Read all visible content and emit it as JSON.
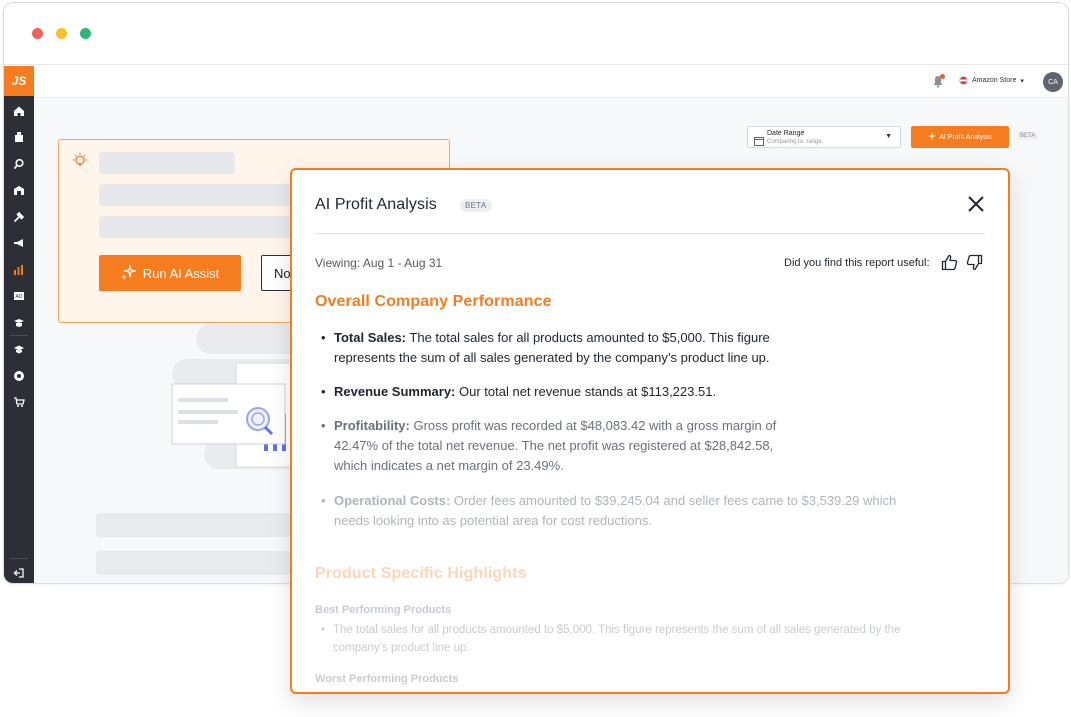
{
  "window": {
    "traffic_lights": [
      "close",
      "minimize",
      "maximize"
    ]
  },
  "sidebar": {
    "logo": "JS",
    "items": [
      {
        "icon": "home-icon"
      },
      {
        "icon": "box-icon"
      },
      {
        "icon": "search-icon"
      },
      {
        "icon": "warehouse-icon"
      },
      {
        "icon": "hammer-icon"
      },
      {
        "icon": "megaphone-icon"
      },
      {
        "icon": "bar-chart-icon",
        "active": true
      },
      {
        "icon": "ad-icon"
      },
      {
        "icon": "graduation-icon"
      },
      {
        "icon": "academy-icon"
      },
      {
        "icon": "chrome-icon"
      },
      {
        "icon": "cart-icon"
      },
      {
        "icon": "logout-icon"
      }
    ]
  },
  "header": {
    "store_label": "Amazon Store",
    "avatar_initials": "CA"
  },
  "toolbar": {
    "date_range_label": "Date Range",
    "date_range_sub": "Comparing to: range",
    "ai_button_label": "AI Profit Analysis",
    "beta_label": "BETA"
  },
  "assist_card": {
    "run_button": "Run AI Assist",
    "no_button": "No,"
  },
  "modal": {
    "title": "AI Profit Analysis",
    "beta": "BETA",
    "viewing": "Viewing: Aug 1 - Aug 31",
    "feedback_prompt": "Did you find this report useful:",
    "section1_title": "Overall Company Performance",
    "bullets": [
      {
        "label": "Total Sales:",
        "line1": " The total sales for all products amounted to $5,000. This figure",
        "line2": "represents the sum of all sales generated by the company’s product line up."
      },
      {
        "label": "Revenue Summary:",
        "line1": " Our total net revenue stands at $113,223.51."
      },
      {
        "label": "Profitability:",
        "line1": " Gross profit was recorded at $48,083.42 with a gross margin of",
        "line2": "42.47% of the total net revenue. The net profit was registered at $28,842.58,",
        "line3": "which indicates a net margin of 23.49%."
      },
      {
        "label": "Operational Costs:",
        "line1": " Order fees amounted to $39,245.04 and seller fees came to $3,539.29 which",
        "line2": "needs looking into as potential area for cost reductions."
      }
    ],
    "section2_title": "Product Specific Highlights",
    "best_title": "Best Performing Products",
    "best_line1": "The total sales for all products amounted to $5,000. This figure represents the sum of all sales generated by the",
    "best_line2": "company’s product line up.",
    "worst_title": "Worst Performing Products"
  },
  "colors": {
    "accent": "#f57c1f",
    "sidebar_bg": "#2c2f36",
    "card_bg": "#fff5eb"
  }
}
